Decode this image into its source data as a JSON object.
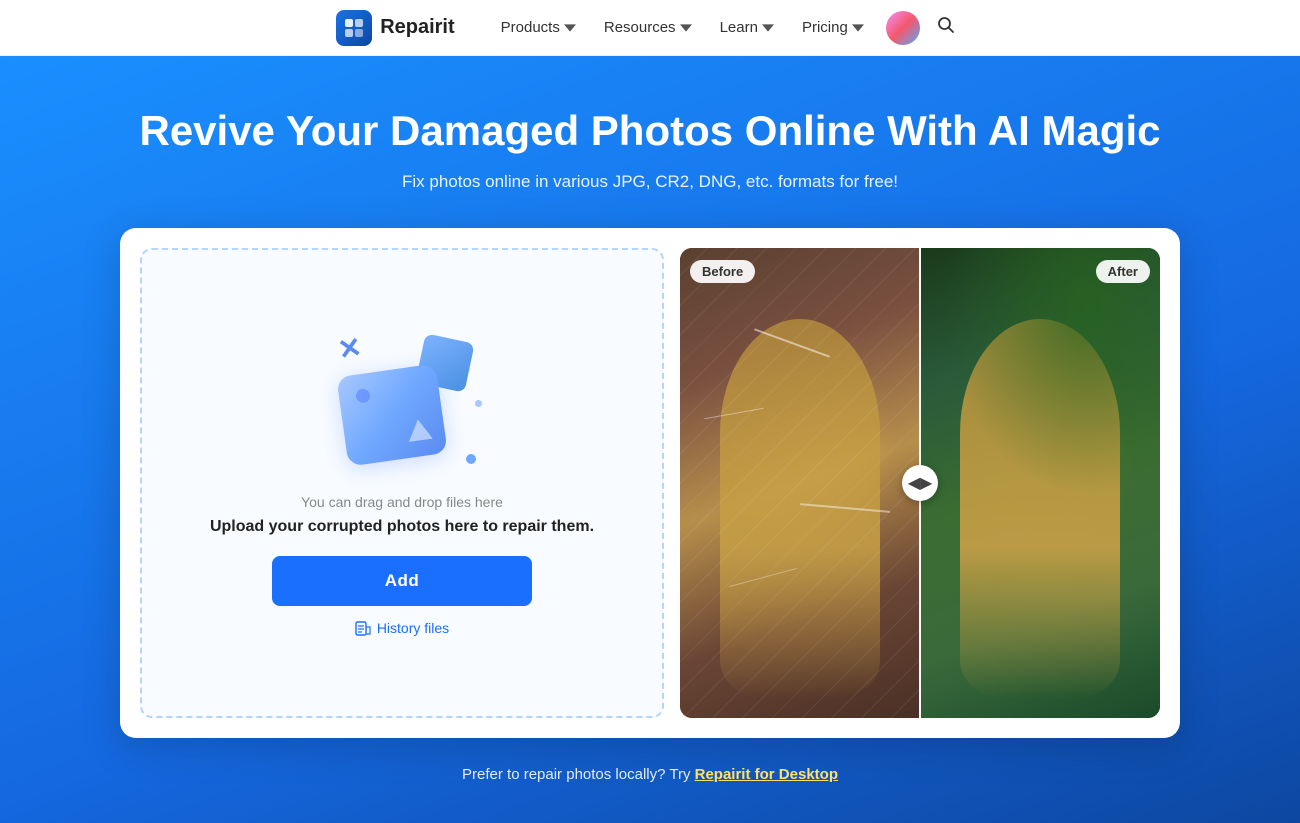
{
  "nav": {
    "logo_text": "Repairit",
    "items": [
      {
        "label": "Products",
        "has_dropdown": true
      },
      {
        "label": "Resources",
        "has_dropdown": true
      },
      {
        "label": "Learn",
        "has_dropdown": true
      },
      {
        "label": "Pricing",
        "has_dropdown": true
      }
    ],
    "search_label": "Search"
  },
  "hero": {
    "title": "Revive Your Damaged Photos Online With AI Magic",
    "subtitle": "Fix photos online in various JPG, CR2, DNG, etc. formats for free!",
    "upload": {
      "drag_msg": "You can drag and drop files here",
      "main_msg": "Upload your corrupted photos here to repair them.",
      "add_btn": "Add",
      "history_label": "History files"
    },
    "before_label": "Before",
    "after_label": "After",
    "bottom_text": "Prefer to repair photos locally? Try ",
    "bottom_link": "Repairit for Desktop"
  }
}
